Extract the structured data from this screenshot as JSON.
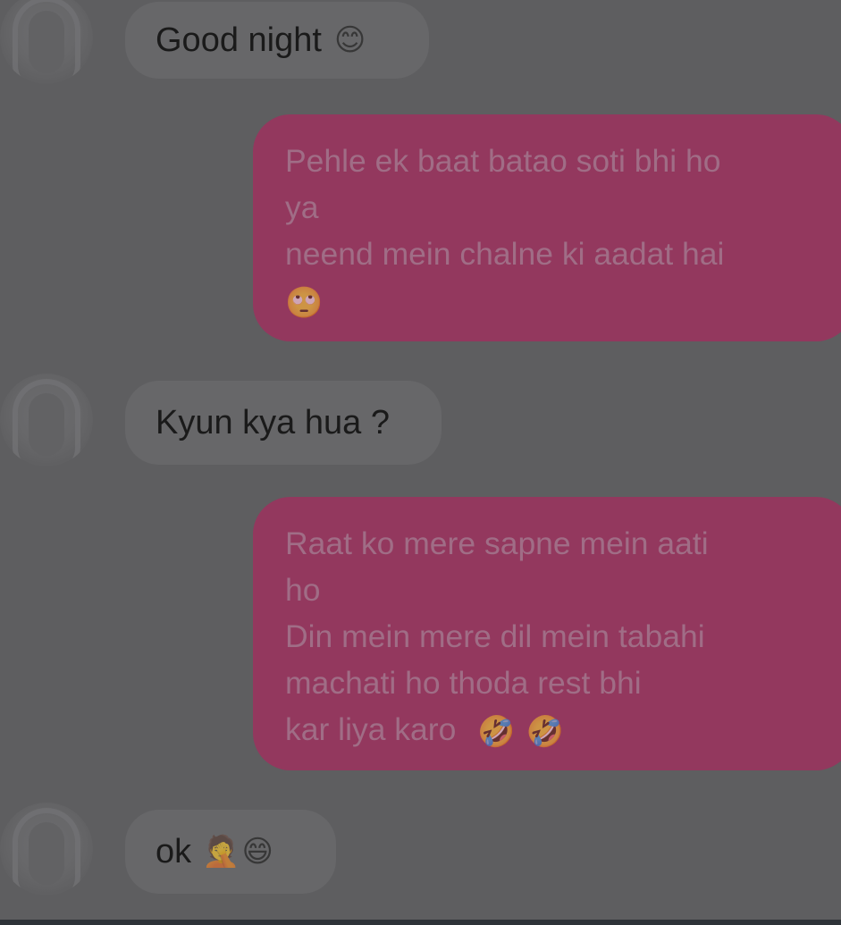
{
  "messages": [
    {
      "from": "them",
      "text": "Good night",
      "emojis": [
        "😊"
      ]
    },
    {
      "from": "me",
      "lines": [
        "Pehle ek baat batao soti bhi ho",
        "ya",
        "neend mein chalne ki aadat hai"
      ],
      "emojis": [
        "🙄"
      ]
    },
    {
      "from": "them",
      "text": "Kyun kya hua ?"
    },
    {
      "from": "me",
      "lines": [
        "Raat ko mere sapne mein aati",
        "ho",
        "Din mein mere dil mein tabahi",
        "machati ho thoda rest bhi",
        "kar liya karo"
      ],
      "emojis": [
        "🤣",
        "🤣"
      ]
    },
    {
      "from": "them",
      "text": "ok",
      "emojis": [
        "🤦",
        "😄"
      ]
    }
  ],
  "colors": {
    "background": "#5e5e60",
    "incoming_bubble": "#676769",
    "outgoing_bubble": "#93385e",
    "incoming_text": "#1a1a1a",
    "outgoing_text": "#a06d86"
  },
  "icons": {
    "avatar": "person-silhouette-avatar"
  }
}
